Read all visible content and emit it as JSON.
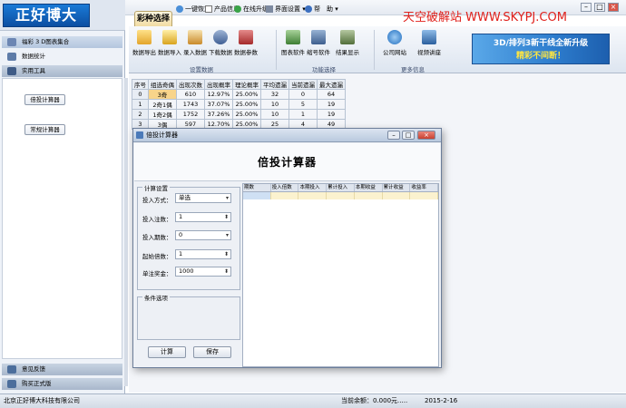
{
  "app": {
    "logo_text": "正好博大",
    "watermark": "天空破解站 WWW.SKYPJ.COM"
  },
  "menubar": {
    "tab_caizhong": "彩种选择",
    "items": [
      {
        "label": "一键恢复",
        "icon": "restore-icon"
      },
      {
        "label": "产品信息",
        "icon": "document-icon"
      },
      {
        "label": "在线升级",
        "icon": "update-icon"
      },
      {
        "label": "界面设置 ▾",
        "icon": "settings-icon"
      },
      {
        "label": "帮",
        "icon": "help-icon"
      },
      {
        "label": "助 ▾",
        "icon": ""
      }
    ],
    "window_buttons": [
      "–",
      "□",
      "×"
    ]
  },
  "ribbon": {
    "groups": [
      {
        "label": "设置数据",
        "buttons": [
          "数据导出",
          "数据导入",
          "录入数据",
          "下载数据",
          "数据参数"
        ]
      },
      {
        "label": "功能选择",
        "buttons": [
          "图表软件",
          "缩号软件",
          "结果显示"
        ]
      },
      {
        "label": "更多信息",
        "buttons": [
          "公司网站",
          "视频讲座"
        ]
      }
    ],
    "banner_line1": "3D/排列3新干线全新升级",
    "banner_line2": "精彩不间断！"
  },
  "sidebar": {
    "items": [
      {
        "label": "福彩 3 D图表集合"
      },
      {
        "label": "数据统计"
      },
      {
        "label": "实用工具"
      }
    ],
    "buttons": [
      "倍投计算器",
      "常规计算器"
    ],
    "bottom_items": [
      "意见反馈",
      "购买正式版"
    ]
  },
  "table": {
    "headers": [
      "序号",
      "组选奇偶",
      "出现次数",
      "出现概率",
      "理论概率",
      "平均遗漏",
      "当前遗漏",
      "最大遗漏"
    ],
    "rows": [
      [
        "0",
        "3奇",
        "610",
        "12.97%",
        "25.00%",
        "32",
        "0",
        "64"
      ],
      [
        "1",
        "2奇1偶",
        "1743",
        "37.07%",
        "25.00%",
        "10",
        "5",
        "19"
      ],
      [
        "2",
        "1奇2偶",
        "1752",
        "37.26%",
        "25.00%",
        "10",
        "1",
        "19"
      ],
      [
        "3",
        "3偶",
        "597",
        "12.70%",
        "25.00%",
        "25",
        "4",
        "49"
      ]
    ]
  },
  "dialog": {
    "title": "倍投计算器",
    "header": "倍投计算器",
    "settings_group": "计算设置",
    "fields": [
      {
        "label": "投入方式：",
        "value": "单选",
        "kind": "dropdown"
      },
      {
        "label": "投入注数：",
        "value": "1",
        "kind": "spinner"
      },
      {
        "label": "投入期数：",
        "value": "0",
        "kind": "dropdown"
      },
      {
        "label": "起始倍数：",
        "value": "1",
        "kind": "spinner"
      },
      {
        "label": "单注奖金：",
        "value": "1000",
        "kind": "spinner"
      }
    ],
    "options_group": "条件选项",
    "calc_button": "计算",
    "save_button": "保存",
    "grid_headers": [
      "期数",
      "投入倍数",
      "本期投入",
      "累计投入",
      "本期收益",
      "累计收益",
      "收益率"
    ]
  },
  "statusbar": {
    "company": "北京正好博大科技有限公司",
    "balance": "当前余额：0.000元.....",
    "date": "2015-2-16"
  }
}
